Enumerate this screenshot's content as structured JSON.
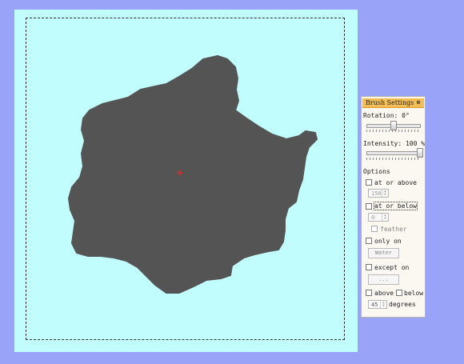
{
  "canvas": {
    "background": "#c2fdfe",
    "land_color": "#545454",
    "cursor_color": "#ff2020"
  },
  "brush_settings": {
    "title": "Brush Settings",
    "pin_icon": "pin-icon",
    "rotation_label": "Rotation: 0°",
    "rotation_value": 0,
    "intensity_label": "Intensity: 100 %",
    "intensity_value": 100,
    "options_label": "Options",
    "at_or_above_label": "at or above",
    "at_or_above_value": "150",
    "at_or_below_label": "at or below",
    "at_or_below_value": "0",
    "feather_label": "feather",
    "only_on_label": "only on",
    "only_on_button": "Water",
    "except_on_label": "except on",
    "except_on_button": "...",
    "above_label": "above",
    "below_label": "below",
    "degrees_value": "45",
    "degrees_label": "degrees"
  }
}
